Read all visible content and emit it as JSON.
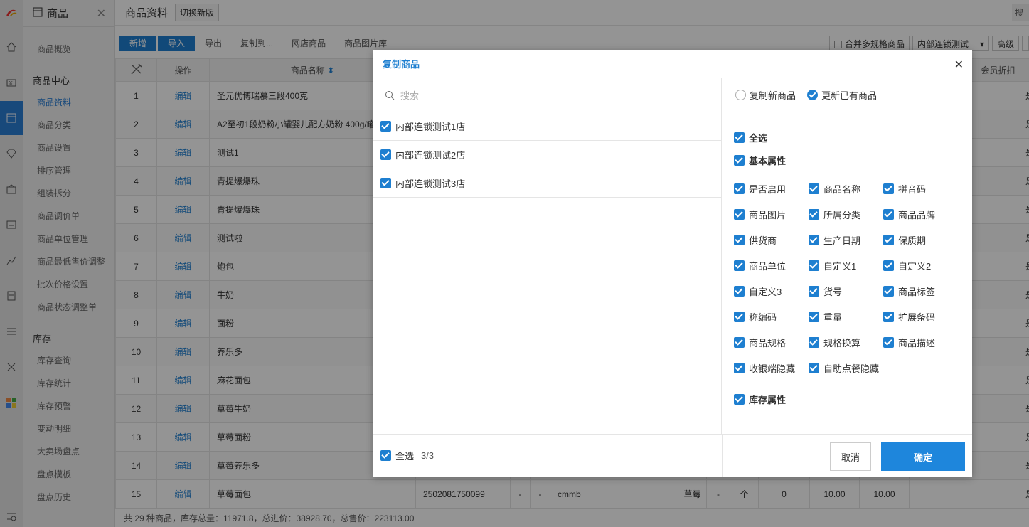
{
  "nav": {
    "module_title": "商品",
    "items": [
      "商品概览"
    ],
    "group1": "商品中心",
    "group1_items": [
      "商品资料",
      "商品分类",
      "商品设置",
      "排序管理",
      "组装拆分",
      "商品调价单",
      "商品单位管理",
      "商品最低售价调整",
      "批次价格设置",
      "商品状态调整单"
    ],
    "group2": "库存",
    "group2_items": [
      "库存查询",
      "库存统计",
      "库存预警",
      "变动明细",
      "大卖场盘点",
      "盘点模板",
      "盘点历史"
    ]
  },
  "page": {
    "title": "商品资料",
    "switch_label": "切换新版",
    "search_label": "搜"
  },
  "toolbar": {
    "new": "新增",
    "import": "导入",
    "export": "导出",
    "copy_to": "复制到...",
    "online_goods": "网店商品",
    "image_lib": "商品图片库"
  },
  "rightbar": {
    "merge": "合并多规格商品",
    "store": "内部连锁测试",
    "advanced": "高级"
  },
  "table": {
    "headers": {
      "op": "操作",
      "name": "商品名称",
      "member_discount": "会员折扣"
    },
    "rows": [
      {
        "no": "1",
        "action": "编辑",
        "name": "圣元优博瑞慕三段400克",
        "flag": "是"
      },
      {
        "no": "2",
        "action": "编辑",
        "name": "A2至初1段奶粉小罐婴儿配方奶粉 400g/罐",
        "flag": "是"
      },
      {
        "no": "3",
        "action": "编辑",
        "name": "测试1",
        "flag": "是"
      },
      {
        "no": "4",
        "action": "编辑",
        "name": "青提爆爆珠",
        "flag": "是"
      },
      {
        "no": "5",
        "action": "编辑",
        "name": "青提爆爆珠",
        "flag": "是"
      },
      {
        "no": "6",
        "action": "编辑",
        "name": "测试啦",
        "flag": "是"
      },
      {
        "no": "7",
        "action": "编辑",
        "name": "炮包",
        "flag": "是"
      },
      {
        "no": "8",
        "action": "编辑",
        "name": "牛奶",
        "flag": "是"
      },
      {
        "no": "9",
        "action": "编辑",
        "name": "面粉",
        "flag": "是"
      },
      {
        "no": "10",
        "action": "编辑",
        "name": "养乐多",
        "flag": "是"
      },
      {
        "no": "11",
        "action": "编辑",
        "name": "麻花面包",
        "flag": "是"
      },
      {
        "no": "12",
        "action": "编辑",
        "name": "草莓牛奶",
        "flag": "是"
      },
      {
        "no": "13",
        "action": "编辑",
        "name": "草莓面粉",
        "flag": "是"
      },
      {
        "no": "14",
        "action": "编辑",
        "name": "草莓养乐多",
        "flag": "是"
      },
      {
        "no": "15",
        "action": "编辑",
        "name": "草莓面包",
        "flag": "是",
        "barcode": "2502081750099",
        "d1": "-",
        "d2": "-",
        "spec": "cmmb",
        "brand": "草莓",
        "d3": "-",
        "unit": "个",
        "stock": "0",
        "price1": "10.00",
        "price2": "10.00"
      }
    ]
  },
  "footer": "共 29 种商品，库存总量：11971.8，总进价：38928.70，总售价：223113.00",
  "dialog": {
    "title": "复制商品",
    "search_placeholder": "搜索",
    "stores": [
      "内部连锁测试1店",
      "内部连锁测试2店",
      "内部连锁测试3店"
    ],
    "mode_new": "复制新商品",
    "mode_update": "更新已有商品",
    "select_all": "全选",
    "basic_attr": "基本属性",
    "attrs": [
      "是否启用",
      "商品名称",
      "拼音码",
      "商品图片",
      "所属分类",
      "商品品牌",
      "供货商",
      "生产日期",
      "保质期",
      "商品单位",
      "自定义1",
      "自定义2",
      "自定义3",
      "货号",
      "商品标签",
      "称编码",
      "重量",
      "扩展条码",
      "商品规格",
      "规格换算",
      "商品描述",
      "收银端隐藏",
      "自助点餐隐藏"
    ],
    "stock_attr": "库存属性",
    "footer_select_all": "全选",
    "footer_count": "3/3",
    "cancel": "取消",
    "confirm": "确定"
  }
}
